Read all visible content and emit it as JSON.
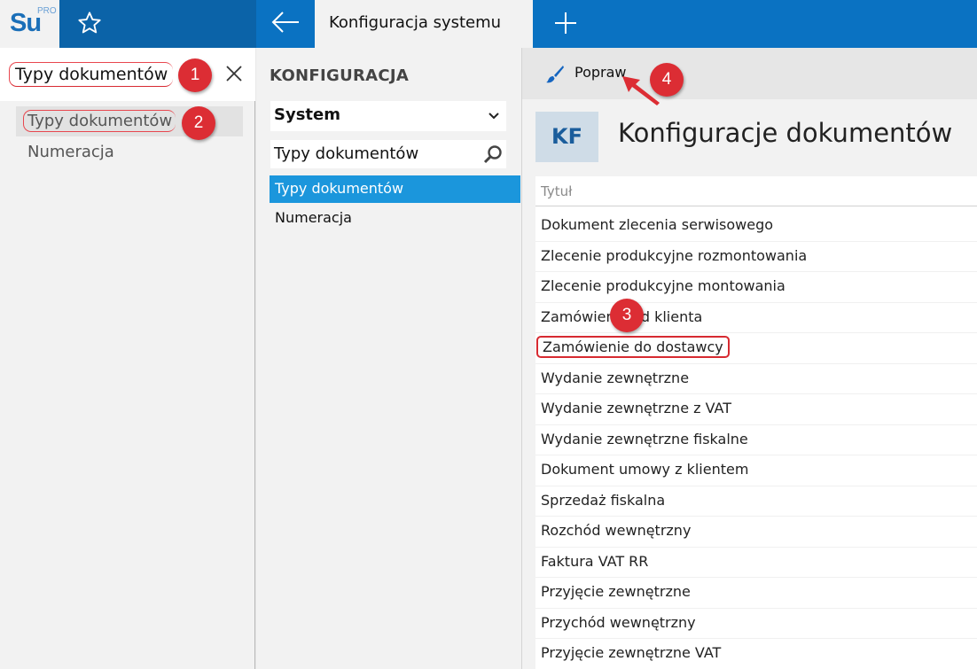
{
  "app": {
    "logo": "Su",
    "logo_badge": "PRO"
  },
  "topbar": {
    "active_tab": "Konfiguracja systemu"
  },
  "left": {
    "search_value": "Typy dokumentów",
    "items": [
      "Typy dokumentów",
      "Numeracja"
    ]
  },
  "middle": {
    "title": "KONFIGURACJA",
    "select_value": "System",
    "search_value": "Typy dokumentów",
    "items": [
      "Typy dokumentów",
      "Numeracja"
    ]
  },
  "right": {
    "toolbar_button": "Popraw",
    "badge": "KF",
    "title": "Konfiguracje dokumentów",
    "column_header": "Tytuł",
    "rows": [
      "Dokument zlecenia serwisowego",
      "Zlecenie produkcyjne rozmontowania",
      "Zlecenie produkcyjne montowania",
      "Zamówienie od klienta",
      "Zamówienie do dostawcy",
      "Wydanie zewnętrzne",
      "Wydanie zewnętrzne z VAT",
      "Wydanie zewnętrzne fiskalne",
      "Dokument umowy z klientem",
      "Sprzedaż fiskalna",
      "Rozchód wewnętrzny",
      "Faktura VAT RR",
      "Przyjęcie zewnętrzne",
      "Przychód wewnętrzny",
      "Przyjęcie zewnętrzne VAT"
    ]
  },
  "callouts": [
    "1",
    "2",
    "3",
    "4"
  ],
  "colors": {
    "accent": "#0a72c2",
    "selected": "#1b96dc",
    "callout": "#dc2d34"
  }
}
